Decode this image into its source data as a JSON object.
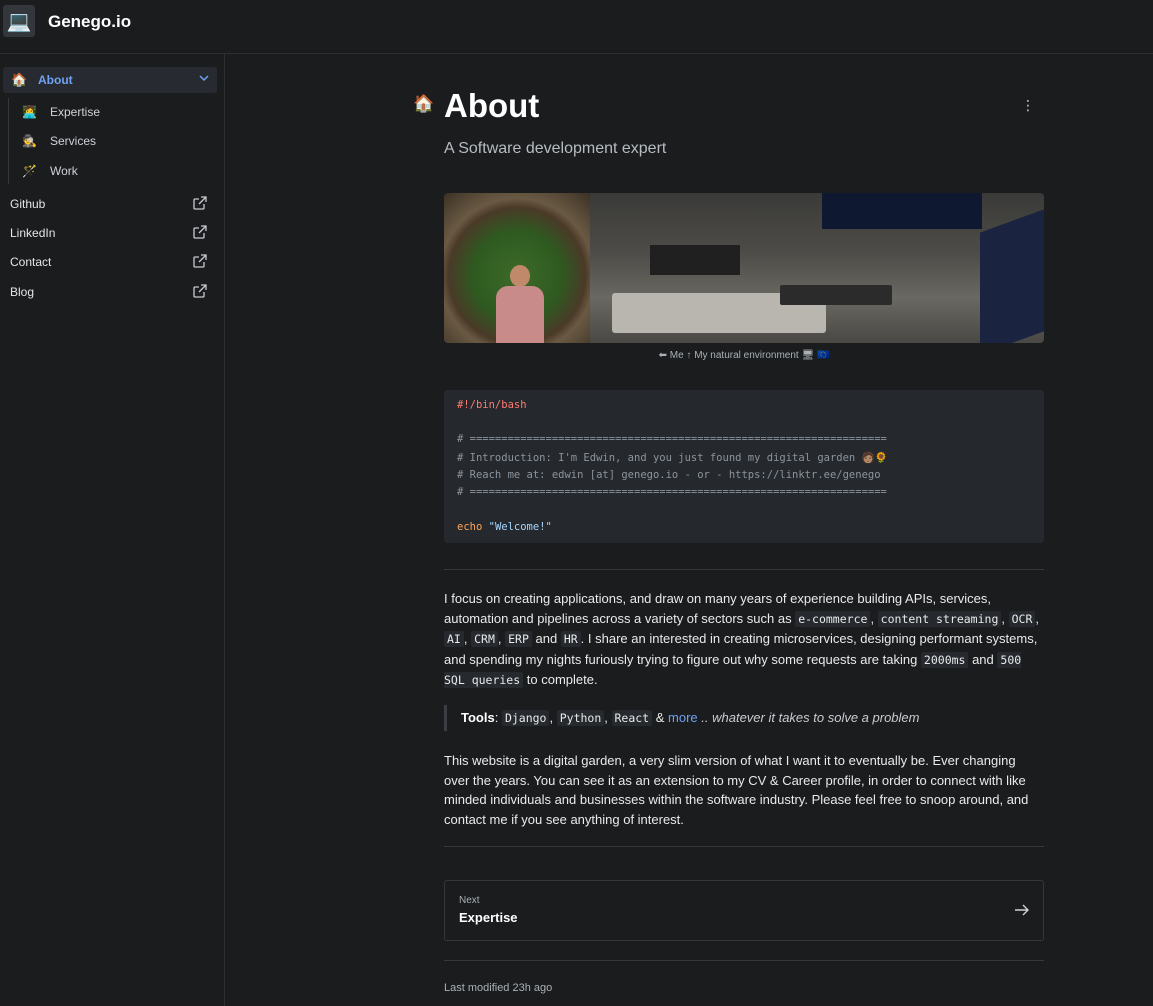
{
  "header": {
    "brand": "Genego.io",
    "logo_icon": "laptop-emoji"
  },
  "sidebar": {
    "active": {
      "label": "About",
      "icon": "house-emoji"
    },
    "sub_items": [
      {
        "label": "Expertise",
        "icon": "technologist-emoji"
      },
      {
        "label": "Services",
        "icon": "detective-emoji"
      },
      {
        "label": "Work",
        "icon": "wand-emoji"
      }
    ],
    "external_links": [
      {
        "label": "Github"
      },
      {
        "label": "LinkedIn"
      },
      {
        "label": "Contact"
      },
      {
        "label": "Blog"
      }
    ]
  },
  "page": {
    "emoji": "🏠",
    "title": "About",
    "subtitle": "A Software development expert",
    "caption": "⬅ Me ↑ My natural environment 🖥 🇪🇺"
  },
  "code": {
    "shebang": "#!/bin/bash",
    "rule": "# ==================================================================",
    "intro": "# Introduction: I'm Edwin, and you just found my digital garden 🧑🏽🌻",
    "reach": "# Reach me at: edwin [at] genego.io - or - https://linktr.ee/genego",
    "keyword": "echo",
    "string": "\"Welcome!\""
  },
  "intro_paragraph": {
    "t1": "I focus on creating applications, and draw on many years of experience building APIs, services, automation and pipelines across a variety of sectors such as ",
    "c1": "e-commerce",
    "s1": ", ",
    "c2": "content streaming",
    "s2": ", ",
    "c3": "OCR",
    "s3": ", ",
    "c4": "AI",
    "s4": ", ",
    "c5": "CRM",
    "s5": ", ",
    "c6": "ERP",
    "s6": " and ",
    "c7": "HR",
    "t2": ". I share an interested in creating microservices, designing performant systems, and spending my nights furiously trying to figure out why some requests are taking ",
    "c8": "2000ms",
    "t3": " and ",
    "c9": "500 SQL queries",
    "t4": " to complete."
  },
  "tools": {
    "label": "Tools",
    "colon": ": ",
    "items": [
      "Django",
      "Python",
      "React"
    ],
    "sep": ", ",
    "amp": " & ",
    "more": "more",
    "tail": " .. whatever it takes to solve a problem"
  },
  "garden_paragraph": "This website is a digital garden, a very slim version of what I want it to eventually be. Ever changing over the years. You can see it as an extension to my CV & Career profile, in order to connect with like minded individuals and businesses within the software industry. Please feel free to snoop around, and contact me if you see anything of interest.",
  "next": {
    "small": "Next",
    "title": "Expertise"
  },
  "footer": {
    "modified": "Last modified 23h ago"
  },
  "colors": {
    "accent": "#6fa2f3",
    "background": "#1a1c1e",
    "code_bg": "#25282c"
  }
}
